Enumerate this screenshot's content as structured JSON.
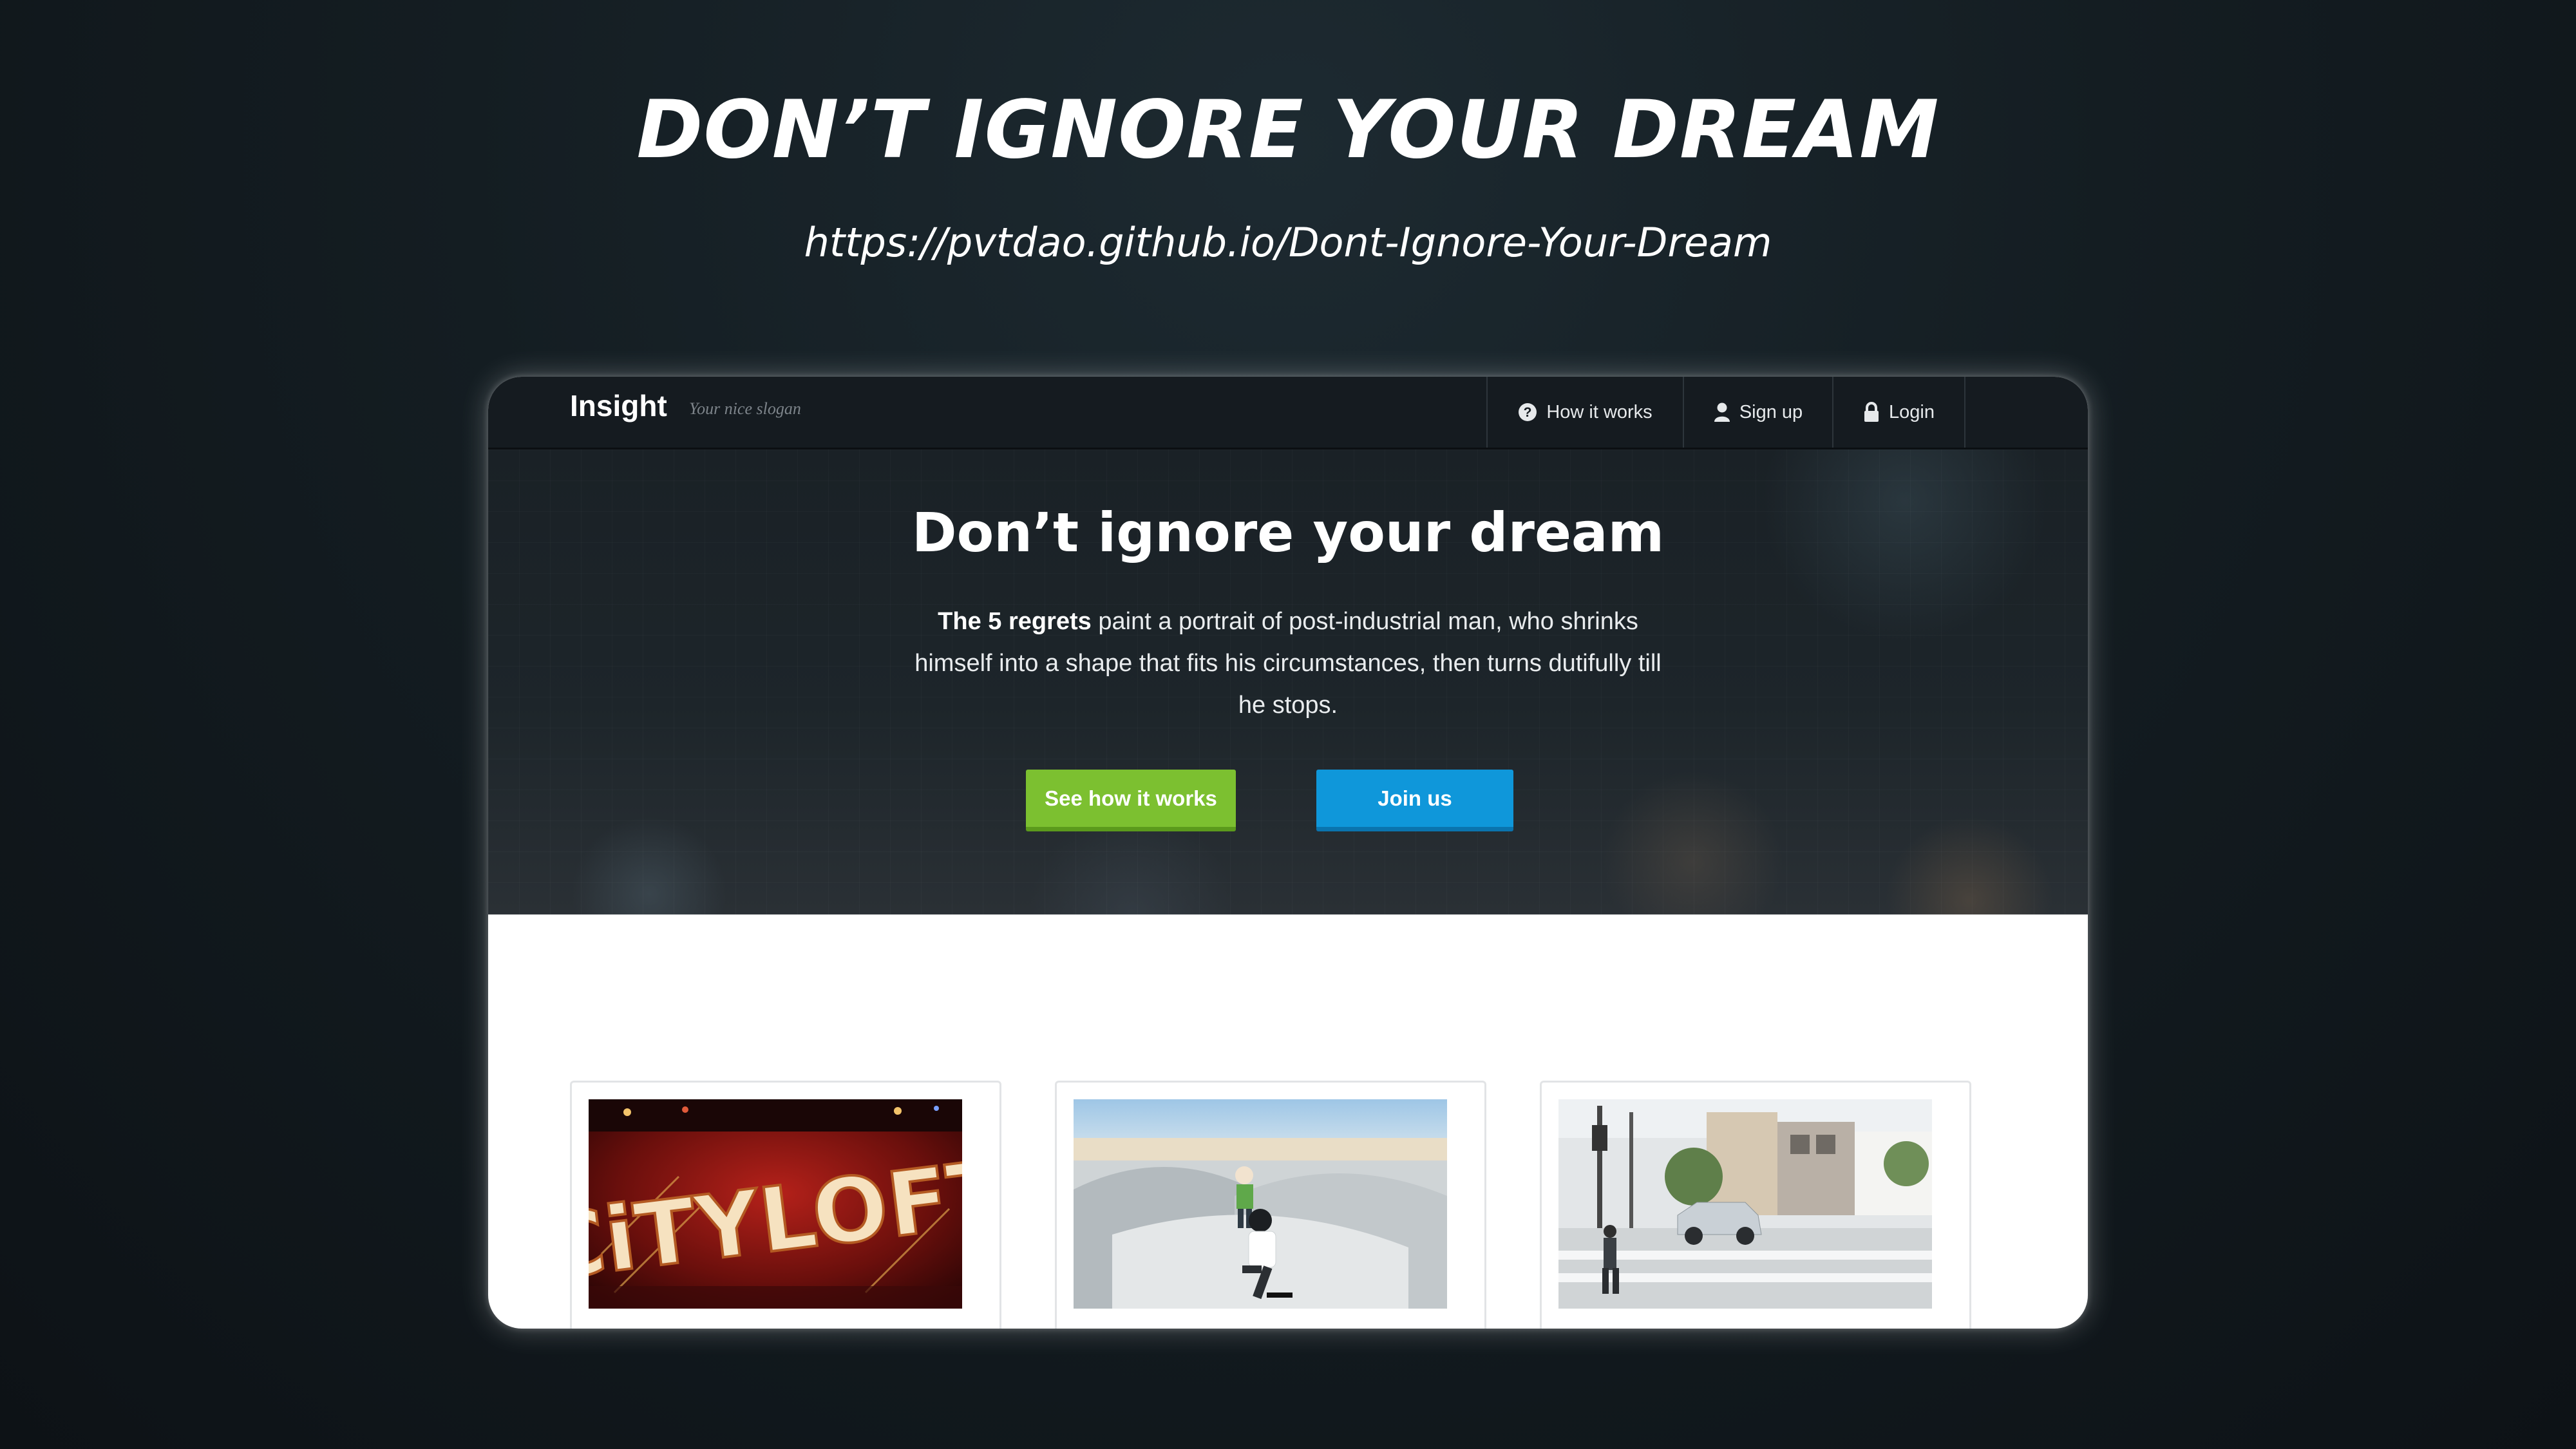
{
  "showcase": {
    "title": "DON’T IGNORE YOUR DREAM",
    "url": "https://pvtdao.github.io/Dont-Ignore-Your-Dream"
  },
  "navbar": {
    "brand": "Insight",
    "slogan": "Your nice slogan",
    "items": [
      {
        "label": "How it works",
        "icon": "question-circle-icon"
      },
      {
        "label": "Sign up",
        "icon": "user-icon"
      },
      {
        "label": "Login",
        "icon": "lock-icon"
      }
    ]
  },
  "hero": {
    "title": "Don’t ignore your dream",
    "text_bold": "The 5 regrets",
    "text_rest": " paint a portrait of post-industrial man, who shrinks himself into a shape that fits his circumstances, then turns dutifully till he stops.",
    "primary_button": "See how it works",
    "secondary_button": "Join us"
  },
  "cards": [
    {
      "image": "city-loft-sign-photo",
      "image_text": "CiTYLOFT"
    },
    {
      "image": "skatepark-photo"
    },
    {
      "image": "street-crossing-photo"
    }
  ],
  "colors": {
    "green_button": "#7cc030",
    "blue_button": "#0f97da",
    "navbar_bg": "#151b20"
  }
}
